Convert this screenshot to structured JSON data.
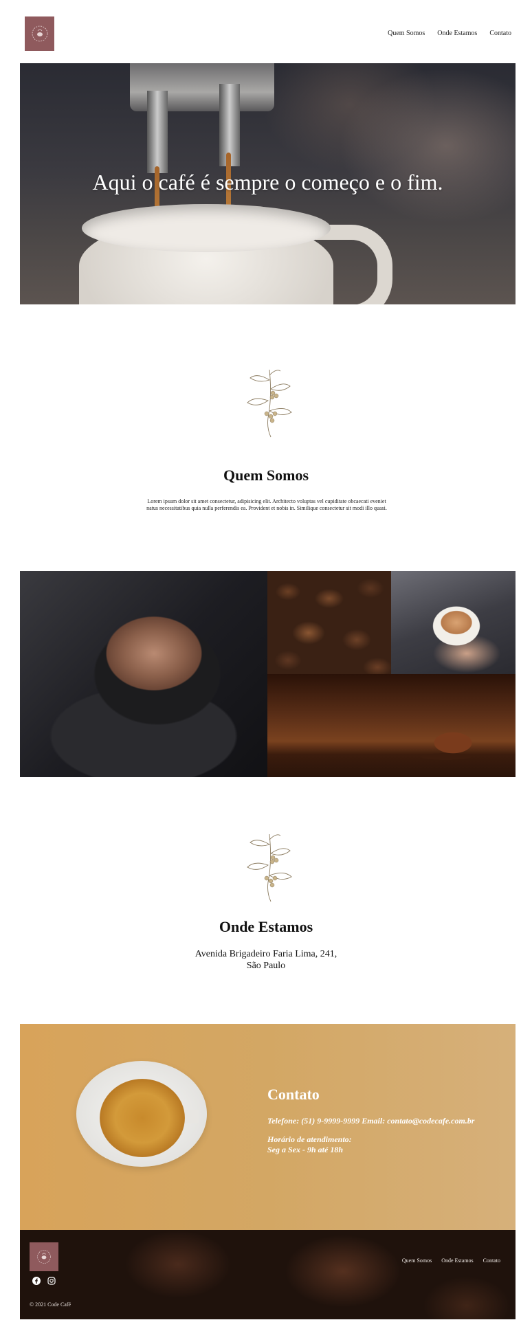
{
  "header": {
    "logo_icon": "cafe-logo-icon",
    "nav": [
      "Quem Somos",
      "Onde Estamos",
      "Contato"
    ]
  },
  "hero": {
    "title": "Aqui o café é sempre o começo e o fim."
  },
  "about": {
    "icon": "coffee-plant-icon",
    "title": "Quem Somos",
    "text": "Lorem ipsum dolor sit amet consectetur, adipisicing elit. Architecto voluptas vel cupiditate obcaecati eveniet natus necessitatibus quia nulla perferendis ea. Provident et nobis in. Similique consectetur sit modi illo quasi."
  },
  "location": {
    "icon": "coffee-plant-icon",
    "title": "Onde Estamos",
    "address_line1": "Avenida Brigadeiro Faria Lima, 241,",
    "address_line2": "São Paulo"
  },
  "contact": {
    "title": "Contato",
    "phone_email": "Telefone: (51) 9-9999-9999 Email: contato@codecafe.com.br",
    "hours_label": "Horário de atendimento:",
    "hours": "Seg a Sex - 9h até 18h"
  },
  "footer": {
    "social": [
      "facebook-icon",
      "instagram-icon"
    ],
    "nav": [
      "Quem Somos",
      "Onde Estamos",
      "Contato"
    ],
    "copyright": "© 2021 Code Café"
  },
  "colors": {
    "logo_bg": "#8f5a5d",
    "contact_bg": "#d6a868",
    "footer_bg": "#1f120c"
  }
}
